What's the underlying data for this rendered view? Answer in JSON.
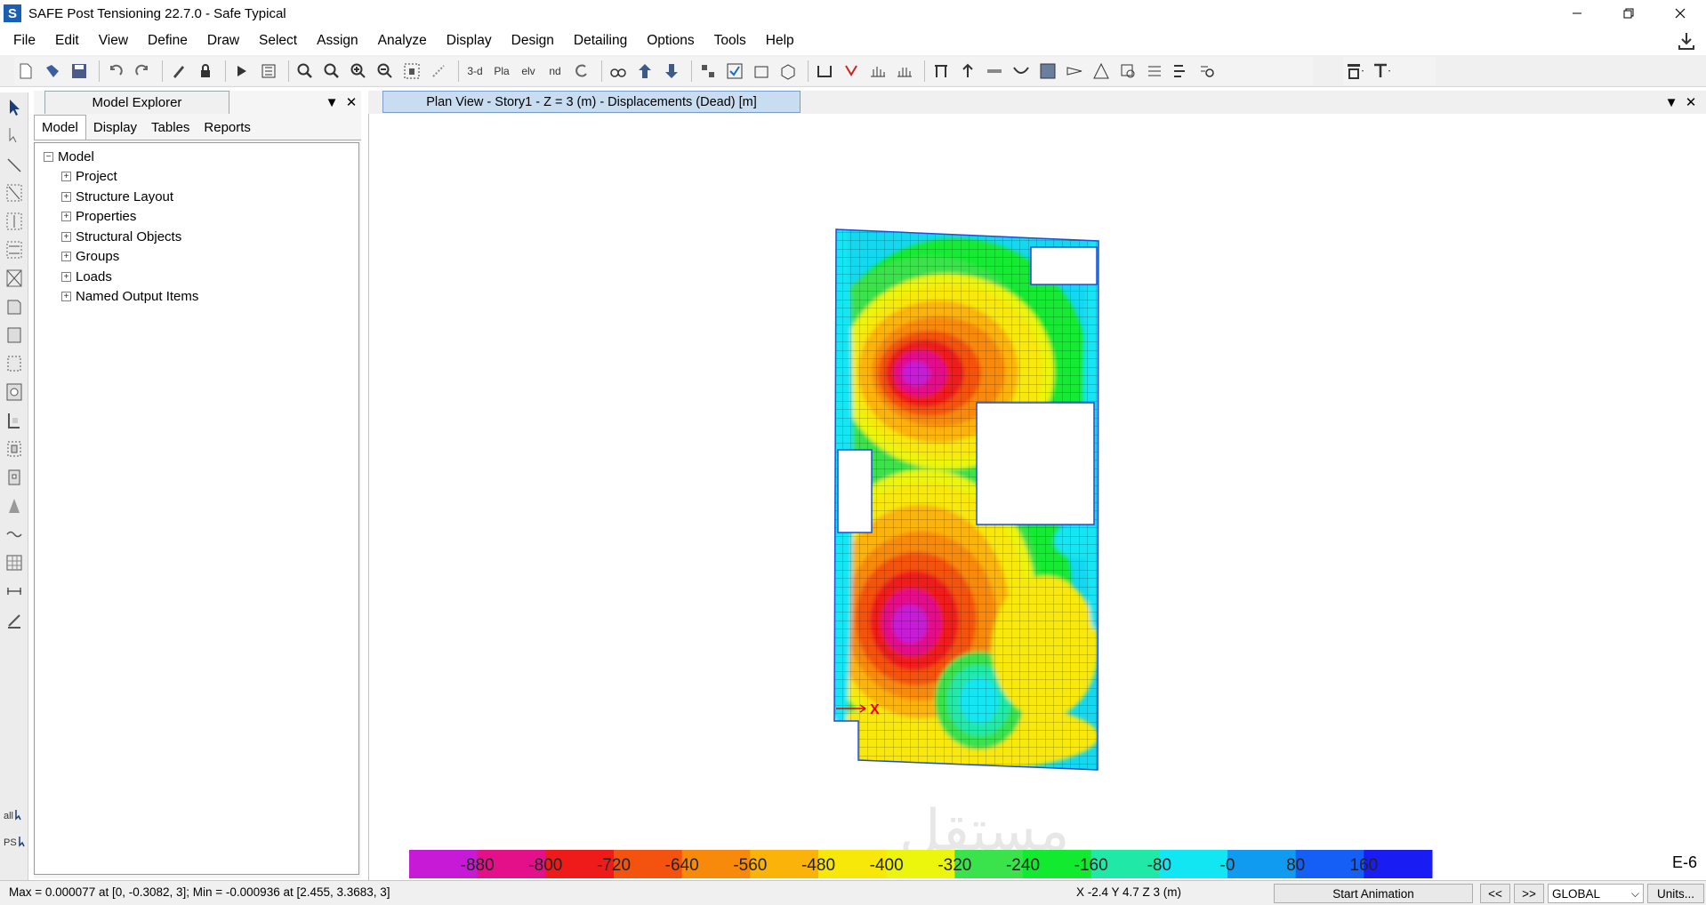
{
  "window": {
    "title": "SAFE Post Tensioning 22.7.0 - Safe Typical",
    "logo_letter": "S"
  },
  "menu": [
    "File",
    "Edit",
    "View",
    "Define",
    "Draw",
    "Select",
    "Assign",
    "Analyze",
    "Display",
    "Design",
    "Detailing",
    "Options",
    "Tools",
    "Help"
  ],
  "toolbar": {
    "view_3d_label": "3-d",
    "plan_label": "Pla",
    "elevation_label": "elv",
    "nd_label": "nd"
  },
  "left_toolbar": {
    "all_label": "all",
    "ps_label": "PS"
  },
  "model_explorer": {
    "title": "Model Explorer",
    "tabs": [
      "Model",
      "Display",
      "Tables",
      "Reports"
    ],
    "active_tab": "Model",
    "root": "Model",
    "items": [
      "Project",
      "Structure Layout",
      "Properties",
      "Structural Objects",
      "Groups",
      "Loads",
      "Named Output Items"
    ]
  },
  "plan_view": {
    "tab_title": "Plan View - Story1 - Z = 3 (m)  - Displacements (Dead)  [m]",
    "axis_label": "X"
  },
  "contour": {
    "values": [
      -880,
      -800,
      -720,
      -640,
      -560,
      -480,
      -400,
      -320,
      -240,
      -160,
      -80,
      0,
      80,
      160
    ],
    "labels": [
      "-880",
      "-800",
      "-720",
      "-640",
      "-560",
      "-480",
      "-400",
      "-320",
      "-240",
      "-160",
      "-80",
      "-0",
      "80",
      "160"
    ],
    "colors": [
      "#c61ad6",
      "#e3108a",
      "#ef1a1a",
      "#f4520f",
      "#f78a0a",
      "#fbb309",
      "#f8e80a",
      "#ecf50c",
      "#3ae24b",
      "#12ea30",
      "#20e9a8",
      "#12e6f3",
      "#109bf0",
      "#155ff6",
      "#1a1df3"
    ],
    "suffix": "E-6"
  },
  "status": {
    "maxmin": "Max = 0.000077 at [0, -0.3082, 3];  Min = -0.000936 at [2.455, 3.3683, 3]",
    "coords": "X -2.4  Y 4.7  Z 3 (m)",
    "start_animation": "Start Animation",
    "prev": "<<",
    "next": ">>",
    "coord_system": "GLOBAL",
    "units": "Units..."
  }
}
